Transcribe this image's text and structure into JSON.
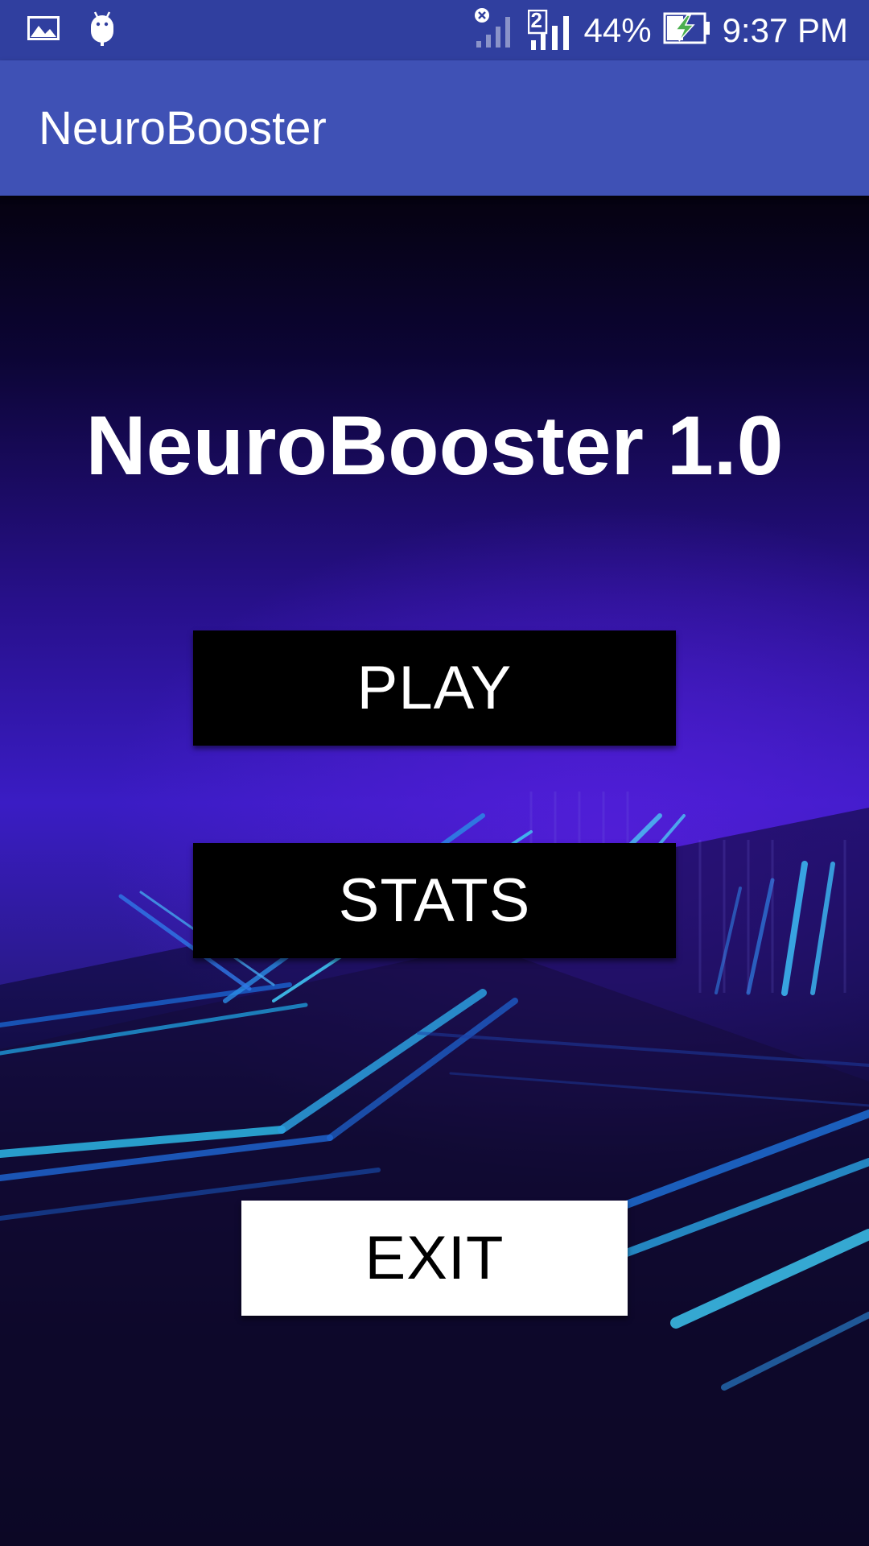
{
  "status_bar": {
    "battery_percent": "44%",
    "time": "9:37 PM",
    "sim2_label": "2",
    "icons": [
      "image-notification-icon",
      "android-debug-icon",
      "signal-no-sim-icon",
      "signal-sim2-icon",
      "battery-charging-icon"
    ]
  },
  "app_bar": {
    "title": "NeuroBooster"
  },
  "main": {
    "title": "NeuroBooster 1.0",
    "buttons": {
      "play": "PLAY",
      "stats": "STATS",
      "exit": "EXIT"
    }
  },
  "colors": {
    "status_bar": "#303f9f",
    "app_bar": "#3f51b5",
    "battery_bolt": "#4caf50"
  }
}
